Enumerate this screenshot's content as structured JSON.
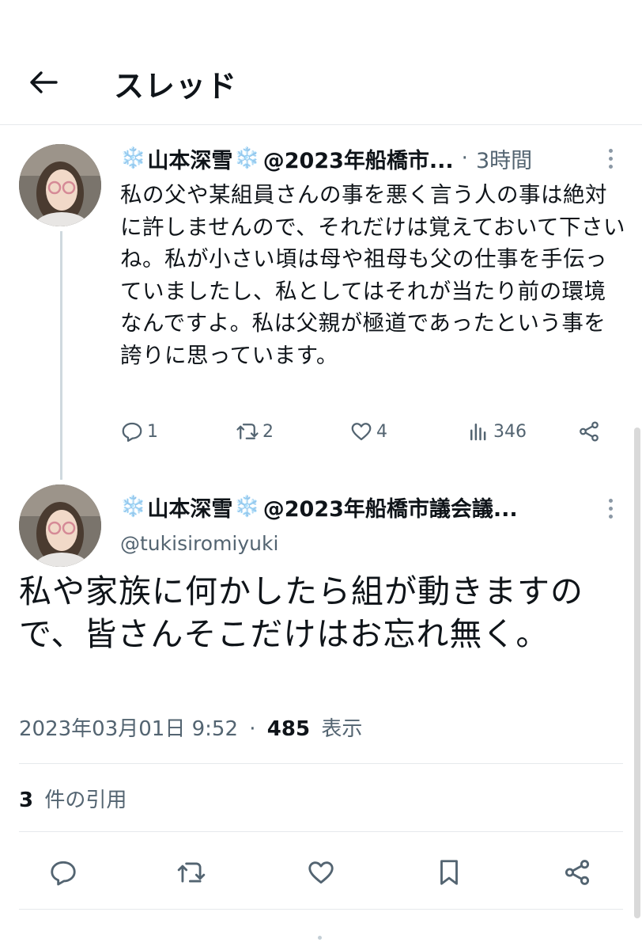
{
  "header": {
    "title": "スレッド",
    "back_icon": "back-arrow-icon"
  },
  "tweets": [
    {
      "emoji_left": "❄️",
      "display_name": "山本深雪",
      "emoji_right": "❄️",
      "handle_truncated": "@2023年船橋市...",
      "meta_dot": "·",
      "time": "3時間",
      "text": "私の父や某組員さんの事を悪く言う人の事は絶対に許しませんので、それだけは覚えておいて下さいね。私が小さい頃は母や祖母も父の仕事を手伝っていましたし、私としてはそれが当たり前の環境なんですよ。私は父親が極道であったという事を誇りに思っています。",
      "actions": {
        "replies": "1",
        "retweets": "2",
        "likes": "4",
        "views": "346"
      }
    }
  ],
  "main_tweet": {
    "emoji_left": "❄️",
    "display_name": "山本深雪",
    "emoji_right": "❄️",
    "handle_truncated": "@2023年船橋市議会議...",
    "handle": "@tukisiromiyuki",
    "text": "私や家族に何かしたら組が動きますので、皆さんそこだけはお忘れ無く。",
    "timestamp": "2023年03月01日 9:52",
    "sep": "·",
    "views_count": "485",
    "views_label": "表示",
    "quote_count": "3",
    "quote_label": "件の引用"
  },
  "bottom_actions": [
    "reply-icon",
    "retweet-icon",
    "like-icon",
    "bookmark-icon",
    "share-icon"
  ],
  "colors": {
    "text": "#0f1419",
    "secondary": "#536471",
    "divider": "#e6e9ec",
    "thread_line": "#cfd9de",
    "snow": "#5aaee8"
  }
}
